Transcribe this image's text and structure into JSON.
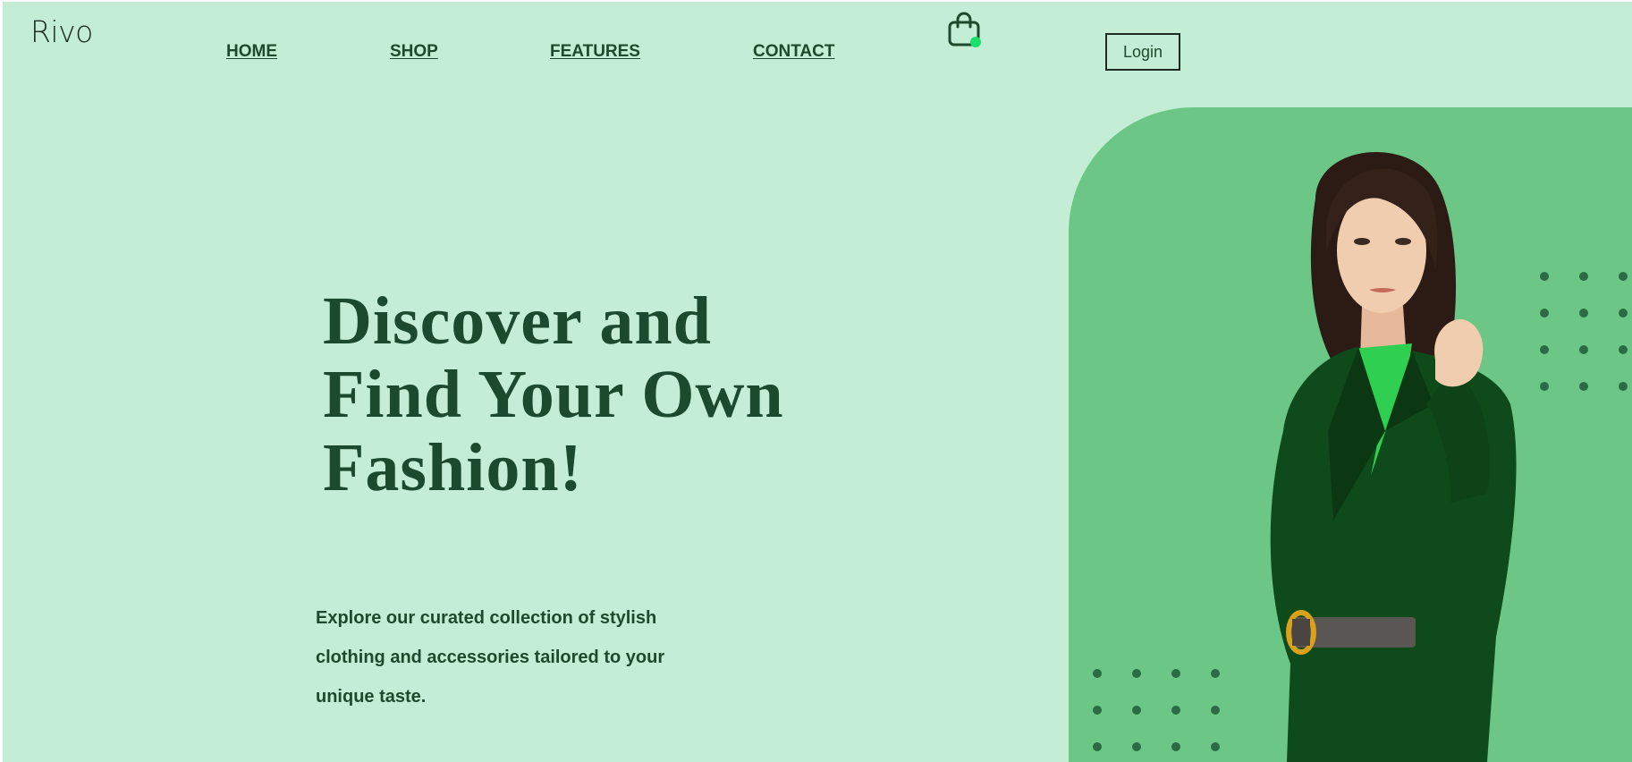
{
  "brand": {
    "logo_text": "Rivo"
  },
  "nav": {
    "items": [
      {
        "label": "HOME"
      },
      {
        "label": "SHOP"
      },
      {
        "label": "FEATURES"
      },
      {
        "label": "CONTACT"
      }
    ]
  },
  "header": {
    "cart_icon": "shopping-bag-icon",
    "cart_badge_color": "#18e06a",
    "login_label": "Login"
  },
  "hero": {
    "headline_lines": [
      "Discover and",
      "Find Your Own",
      "Fashion!"
    ],
    "description": "Explore our curated collection of stylish clothing and accessories tailored to your unique taste.",
    "image": "woman-in-green-suit-photo"
  },
  "colors": {
    "background": "#c3eed5",
    "accent_panel": "#6cc786",
    "text_dark": "#1c4a2e",
    "dots": "#2a6b44"
  }
}
